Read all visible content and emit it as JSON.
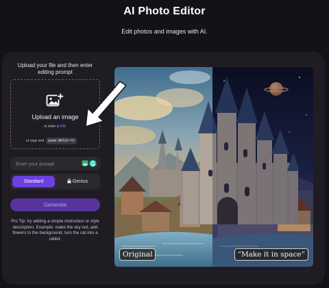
{
  "header": {
    "title": "AI Photo Editor",
    "subtitle": "Edit photos and images with AI."
  },
  "upload": {
    "heading": "Upload your file and then enter editing prompt",
    "icon": "image-plus-icon",
    "button_label": "Upload an image",
    "or_enter": "or enter a",
    "url_link": "URL",
    "or_copy": "or copy and",
    "paste_badge": "paste (⌘/Ctrl +V)"
  },
  "prompt": {
    "placeholder": "Enter your prompt",
    "value": ""
  },
  "modes": {
    "standard_label": "Standard",
    "genius_label": "Genius",
    "selected": "Standard"
  },
  "generate": {
    "label": "Generate",
    "enabled": false
  },
  "tip": {
    "text": "Pro Tip: try adding a simple instruction or style description. Example: make the sky red, add flowers to the background, turn the cat into a rabbit."
  },
  "preview": {
    "original_label": "Original",
    "edited_label": "“Make it in space”"
  },
  "colors": {
    "background": "#141217",
    "card": "#1f1c24",
    "accent": "#6b3fe0",
    "generate_disabled": "#57339e",
    "link": "#8f7bff"
  }
}
